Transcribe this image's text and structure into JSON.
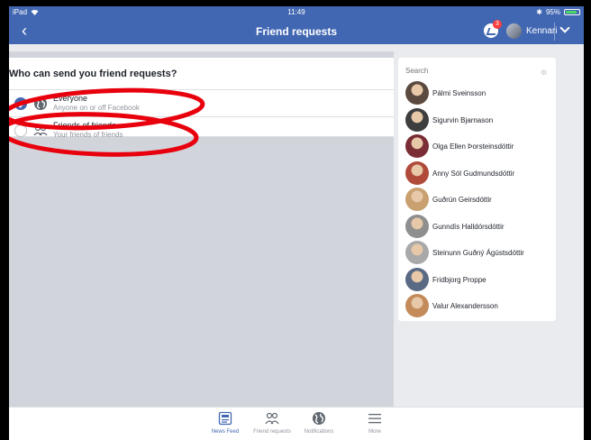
{
  "status_bar": {
    "device": "iPad",
    "time": "11:49",
    "battery": "95%"
  },
  "nav": {
    "title": "Friend requests",
    "messenger_badge": "3",
    "user_name": "Kennari"
  },
  "privacy": {
    "question": "Who can send you friend requests?",
    "options": [
      {
        "label": "Everyone",
        "sub": "Anyone on or off Facebook",
        "selected": true
      },
      {
        "label": "Friends of friends",
        "sub": "Your friends of friends",
        "selected": false
      }
    ]
  },
  "sidebar": {
    "search_placeholder": "Search",
    "friends": [
      {
        "name": "Pálmi Sveinsson",
        "color": "#5b4a3f"
      },
      {
        "name": "Sigurvin Bjarnason",
        "color": "#3e3e3e"
      },
      {
        "name": "Olga Ellen Þorsteinsdóttir",
        "color": "#7a2d34"
      },
      {
        "name": "Anny Sól Gudmundsdóttir",
        "color": "#b04a3a"
      },
      {
        "name": "Guðrún Geirsdóttir",
        "color": "#c9a070"
      },
      {
        "name": "Gunndís Halldórsdóttir",
        "color": "#8f8f8f"
      },
      {
        "name": "Steinunn Guðný Ágústsdóttir",
        "color": "#a9a9a9"
      },
      {
        "name": "Fridbjorg Proppe",
        "color": "#5a6a85"
      },
      {
        "name": "Valur Alexandersson",
        "color": "#c48b5a"
      }
    ]
  },
  "tabs": [
    {
      "label": "News Feed",
      "icon": "news-feed-icon",
      "active": true
    },
    {
      "label": "Friend requests",
      "icon": "friends-icon",
      "active": false
    },
    {
      "label": "Notifications",
      "icon": "globe-icon",
      "active": false
    },
    {
      "label": "More",
      "icon": "menu-icon",
      "active": false
    }
  ],
  "colors": {
    "brand": "#4267b2",
    "annotation": "#e8000d"
  }
}
